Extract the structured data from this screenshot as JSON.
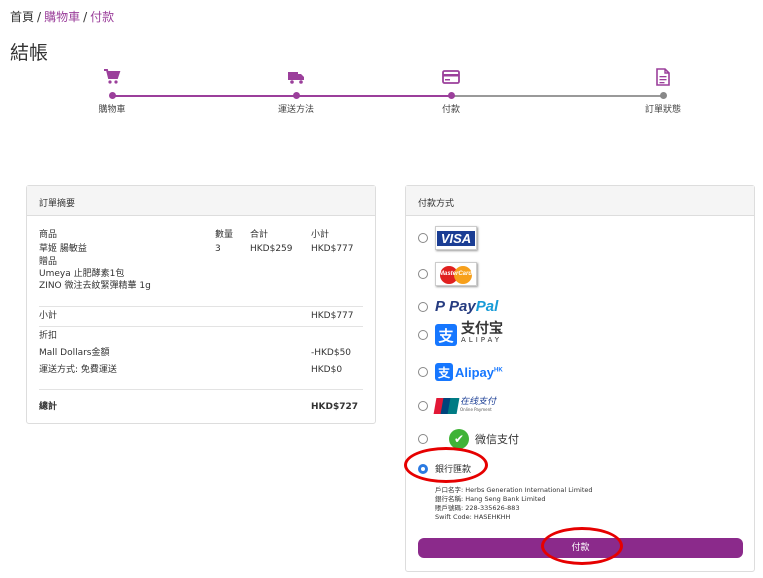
{
  "breadcrumb": {
    "home": "首頁",
    "sep": "/",
    "cart": "購物車",
    "current": "付款"
  },
  "page_title": "結帳",
  "stepper": {
    "steps": [
      {
        "label": "購物車",
        "icon": "cart-icon",
        "done": true
      },
      {
        "label": "運送方法",
        "icon": "truck-icon",
        "done": true
      },
      {
        "label": "付款",
        "icon": "credit-card-icon",
        "done": true
      },
      {
        "label": "訂單狀態",
        "icon": "document-icon",
        "done": false
      }
    ]
  },
  "summary": {
    "title": "訂單摘要",
    "headers": {
      "product": "商品",
      "qty": "數量",
      "total": "合計",
      "subtotal": "小計"
    },
    "item": {
      "name": "草姬 腸敏益",
      "qty": "3",
      "total": "HKD$259",
      "subtotal": "HKD$777"
    },
    "gift_title": "贈品",
    "gifts": [
      "Umeya 止肥酵素1包",
      "ZINO 微注去紋緊彈精華 1g"
    ],
    "subtotal_label": "小計",
    "subtotal_value": "HKD$777",
    "discount_label": "折扣",
    "mall_dollars_label": "Mall Dollars金額",
    "mall_dollars_value": "-HKD$50",
    "shipping_label": "運送方式: 免費運送",
    "shipping_value": "HKD$0",
    "grand_total_label": "總計",
    "grand_total_value": "HKD$727"
  },
  "payment": {
    "title": "付款方式",
    "options": {
      "visa": "VISA",
      "mastercard": "MasterCard",
      "paypal_a": "Pay",
      "paypal_b": "Pal",
      "alipay_big": "支付宝",
      "alipay_small": "ALIPAY",
      "alipay_hk": "Alipay",
      "alipay_hk_sup": "HK",
      "unionpay": "在线支付",
      "unionpay_small": "Online Payment",
      "wechat": "微信支付",
      "bank": "銀行匯款"
    },
    "selected": "bank",
    "bank_info": {
      "account_name": "戶口名字: Herbs Generation International Limited",
      "bank_name": "銀行名稱: Hang Seng Bank Limited",
      "account_no": "賬戶號碼: 228-335626-883",
      "swift": "Swift Code: HASEHKHH"
    },
    "pay_button": "付款"
  },
  "colors": {
    "accent": "#9b3f9b",
    "button": "#8b2a8b",
    "annotation": "#e60000",
    "radio_checked": "#2a7ae2"
  }
}
